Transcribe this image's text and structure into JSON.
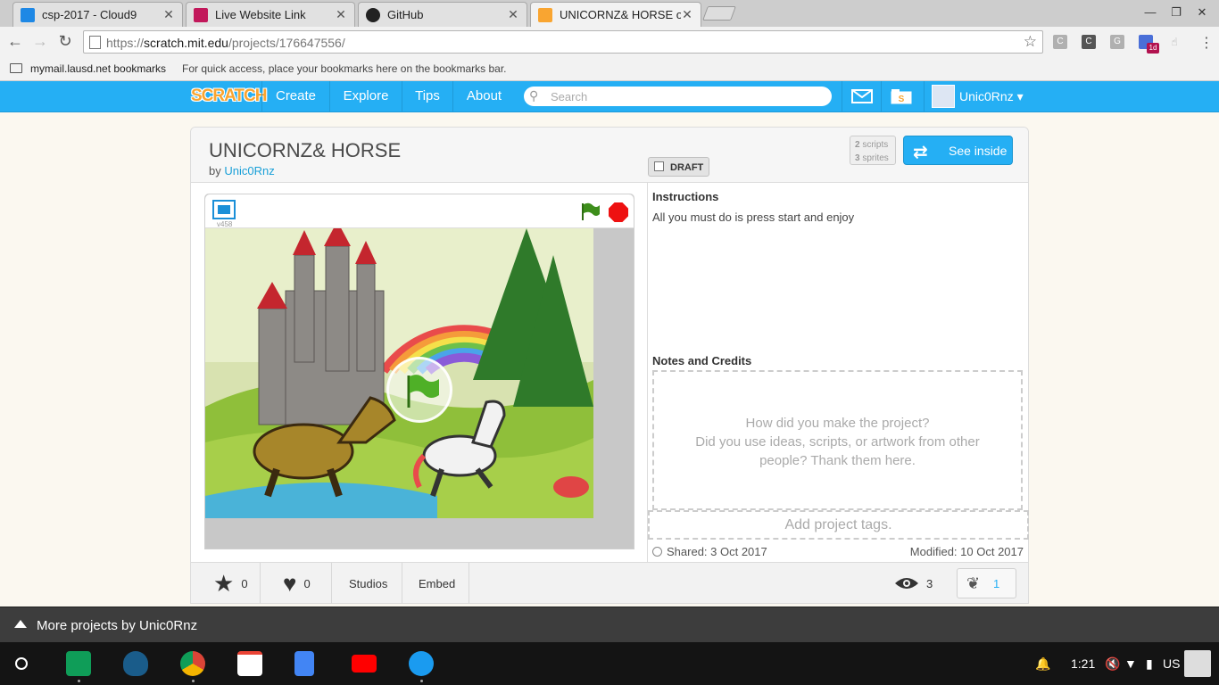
{
  "browser": {
    "tabs": [
      {
        "title": "csp-2017 - Cloud9",
        "icon": "cloud9-icon",
        "color": "#1e88e5"
      },
      {
        "title": "Live Website Link",
        "icon": "link-icon",
        "color": "#c2185b"
      },
      {
        "title": "GitHub",
        "icon": "github-icon",
        "color": "#222222"
      },
      {
        "title": "UNICORNZ& HORSE on S",
        "icon": "scratch-icon",
        "color": "#f9a531"
      }
    ],
    "url_prefix": "https://",
    "url_host": "scratch.mit.edu",
    "url_path": "/projects/176647556/",
    "extensions": [
      "C",
      "C",
      "G",
      "1d"
    ],
    "bookmarks_folder": "mymail.lausd.net bookmarks",
    "bookmarks_hint": "For quick access, place your bookmarks here on the bookmarks bar."
  },
  "scratch_nav": {
    "logo": "SCRATCH",
    "links": [
      "Create",
      "Explore",
      "Tips",
      "About"
    ],
    "search_placeholder": "Search",
    "username": "Unic0Rnz",
    "brand_color": "#25aff4"
  },
  "project": {
    "title": "UNICORNZ& HORSE",
    "by_prefix": "by",
    "author": "Unic0Rnz",
    "draft_label": "DRAFT",
    "scripts_count": "2",
    "scripts_label": "scripts",
    "sprites_count": "3",
    "sprites_label": "sprites",
    "see_inside": "See inside",
    "player_version": "v458",
    "instructions_title": "Instructions",
    "instructions_text": "All you must do is press start and enjoy",
    "notes_title": "Notes and Credits",
    "notes_line1": "How did you make the project?",
    "notes_line2": "Did you use ideas, scripts, or artwork from other",
    "notes_line3": "people? Thank them here.",
    "tags_placeholder": "Add project tags.",
    "shared": "Shared: 3 Oct 2017",
    "modified": "Modified: 10 Oct 2017"
  },
  "actions": {
    "loves": "0",
    "favorites": "0",
    "studios": "Studios",
    "embed": "Embed",
    "views": "3",
    "remixes": "1"
  },
  "more_projects": "More projects by Unic0Rnz",
  "shelf": {
    "apps": [
      {
        "name": "classroom-icon",
        "color": "#0f9d58"
      },
      {
        "name": "shield-app-icon",
        "color": "#1a5c8a"
      },
      {
        "name": "chrome-icon",
        "color": "#db4437"
      },
      {
        "name": "gmail-icon",
        "color": "#ea4335"
      },
      {
        "name": "docs-icon",
        "color": "#4285f4"
      },
      {
        "name": "youtube-icon",
        "color": "#ff0000"
      },
      {
        "name": "files-icon",
        "color": "#1a9bf0"
      }
    ],
    "time": "1:21",
    "locale": "US"
  }
}
